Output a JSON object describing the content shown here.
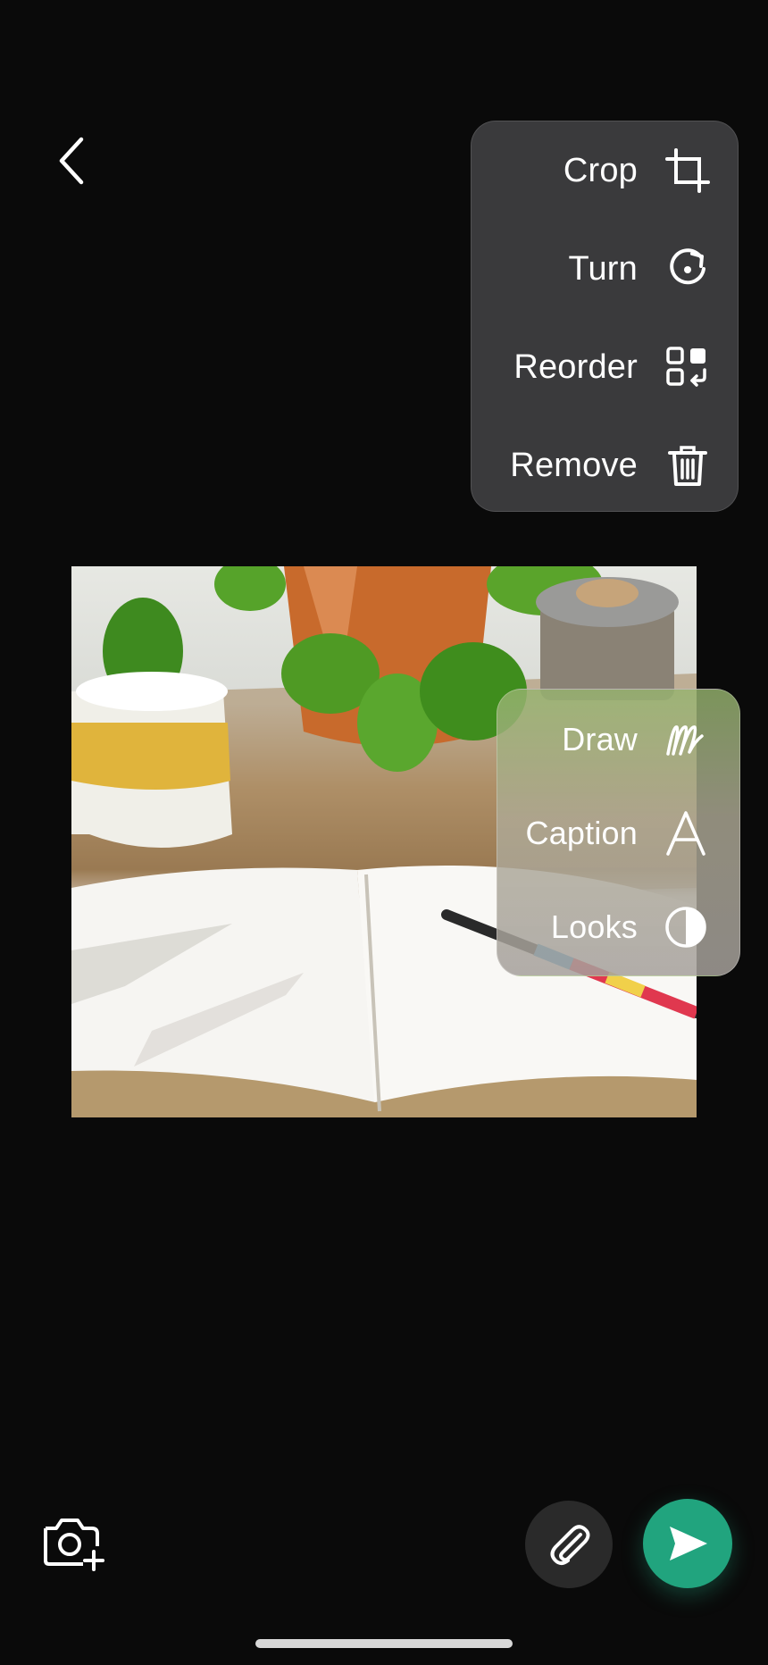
{
  "top_menu": {
    "items": [
      {
        "label": "Crop",
        "icon": "crop-icon"
      },
      {
        "label": "Turn",
        "icon": "rotate-icon"
      },
      {
        "label": "Reorder",
        "icon": "reorder-icon"
      },
      {
        "label": "Remove",
        "icon": "trash-icon"
      }
    ]
  },
  "edit_menu": {
    "items": [
      {
        "label": "Draw",
        "icon": "draw-icon"
      },
      {
        "label": "Caption",
        "icon": "caption-icon"
      },
      {
        "label": "Looks",
        "icon": "looks-icon"
      }
    ]
  },
  "colors": {
    "background": "#0a0a0a",
    "menu": "#3a3a3c",
    "send": "#21a47e"
  }
}
